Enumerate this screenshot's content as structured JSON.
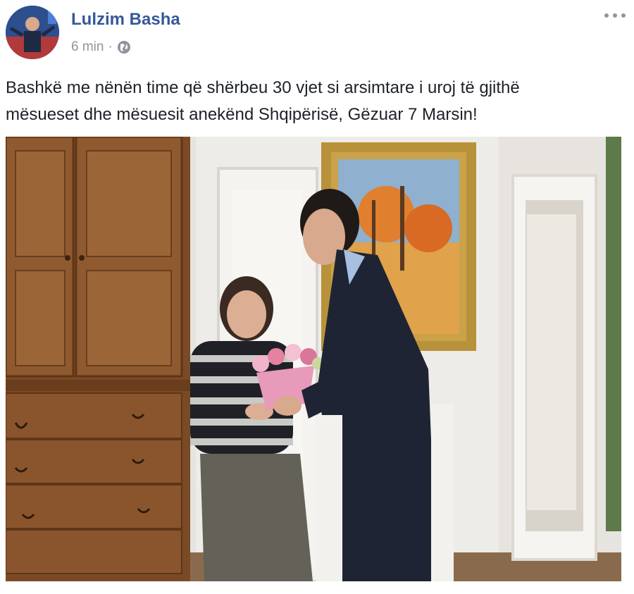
{
  "post": {
    "author": "Lulzim Basha",
    "time": "6 min",
    "separator": "·",
    "privacy_icon": "globe-icon",
    "more_icon": "more-options-icon",
    "text_line1": "Bashkë me nënën time që shërbeu 30 vjet si arsimtare i uroj të gjithë",
    "text_line2": "mësueset dhe mësuesit anekënd Shqipërisë, Gëzuar 7 Marsin!"
  },
  "colors": {
    "author_link": "#365899",
    "meta_text": "#90949c",
    "body_text": "#1d2129"
  }
}
